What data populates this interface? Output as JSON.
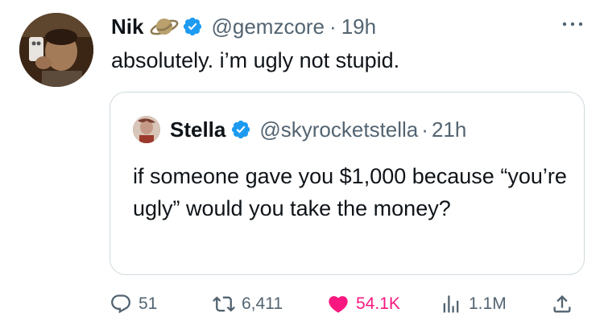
{
  "tweet": {
    "author": {
      "display_name": "Nik",
      "name_emoji": "ringed-planet-emoji-icon",
      "verified": true,
      "handle": "@gemzcore",
      "separator": "·",
      "time": "19h"
    },
    "text": "absolutely. i’m ugly not stupid.",
    "more_icon": "more-dots-icon"
  },
  "quote": {
    "author": {
      "display_name": "Stella",
      "verified": true,
      "handle": "@skyrocketstella",
      "separator": "·",
      "time": "21h"
    },
    "text": "if someone gave you $1,000 because “you’re ugly” would you take the money?"
  },
  "actions": {
    "reply": {
      "icon": "reply-icon",
      "count": "51"
    },
    "retweet": {
      "icon": "retweet-icon",
      "count": "6,411"
    },
    "like": {
      "icon": "heart-icon",
      "count": "54.1K",
      "active": true
    },
    "views": {
      "icon": "views-icon",
      "count": "1.1M"
    },
    "share": {
      "icon": "share-icon"
    }
  },
  "colors": {
    "text": "#0f1419",
    "secondary": "#536471",
    "verified_blue": "#1d9bf0",
    "like_pink": "#f91880",
    "border": "#cfd9de"
  }
}
